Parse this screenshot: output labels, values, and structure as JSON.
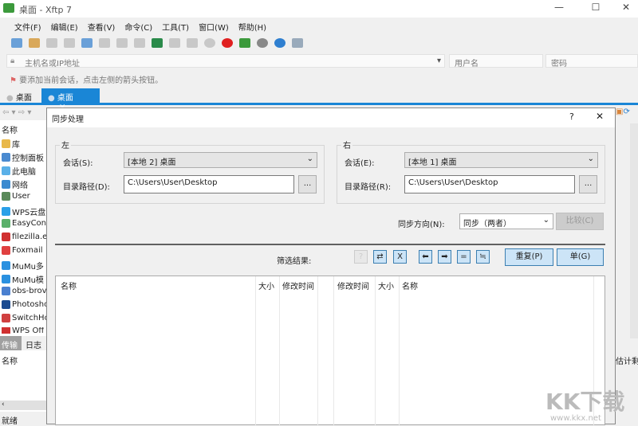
{
  "window": {
    "title": "桌面 - Xftp 7",
    "minimize": "—",
    "maximize": "☐",
    "close": "✕"
  },
  "menu": [
    "文件(F)",
    "编辑(E)",
    "查看(V)",
    "命令(C)",
    "工具(T)",
    "窗口(W)",
    "帮助(H)"
  ],
  "address": {
    "placeholder": "主机名或IP地址",
    "username": "用户名",
    "password": "密码"
  },
  "hint": "要添加当前会话，点击左侧的箭头按钮。",
  "tabs": [
    {
      "label": "桌面",
      "active": false
    },
    {
      "label": "桌面",
      "active": true,
      "close": "×"
    }
  ],
  "left_pane": {
    "header": "名称",
    "items": [
      "库",
      "控制面板",
      "此电脑",
      "网络",
      "User",
      "WPS云盘",
      "EasyConn",
      "filezilla.ex",
      "Foxmail",
      "MuMu多",
      "MuMu模",
      "obs-brov",
      "Photosho",
      "SwitchHo",
      "WPS Off"
    ],
    "bottom_tabs": [
      "传输",
      "日志"
    ],
    "bottom_header": "名称",
    "status": "就绪"
  },
  "right_edge": {
    "column": "估计剩"
  },
  "dialog": {
    "title": "同步处理",
    "help": "?",
    "close": "✕",
    "left": {
      "title": "左",
      "session_label": "会话(S):",
      "session_value": "[本地 2] 桌面",
      "path_label": "目录路径(D):",
      "path_value": "C:\\Users\\User\\Desktop",
      "browse": "..."
    },
    "right": {
      "title": "右",
      "session_label": "会话(E):",
      "session_value": "[本地 1] 桌面",
      "path_label": "目录路径(R):",
      "path_value": "C:\\Users\\User\\Desktop",
      "browse": "..."
    },
    "direction_label": "同步方向(N):",
    "direction_value": "同步（两者）",
    "compare": "比较(C)",
    "filter_label": "筛选结果:",
    "filter_buttons": [
      "?",
      "⇄",
      "X",
      "⬅",
      "➡",
      "=",
      "≒"
    ],
    "duplicate": "重复(P)",
    "single": "单(G)",
    "columns": [
      "名称",
      "大小",
      "修改时间",
      "修改时间",
      "大小",
      "名称"
    ]
  },
  "watermark": {
    "text": "KK下载",
    "url": "www.kkx.net"
  }
}
